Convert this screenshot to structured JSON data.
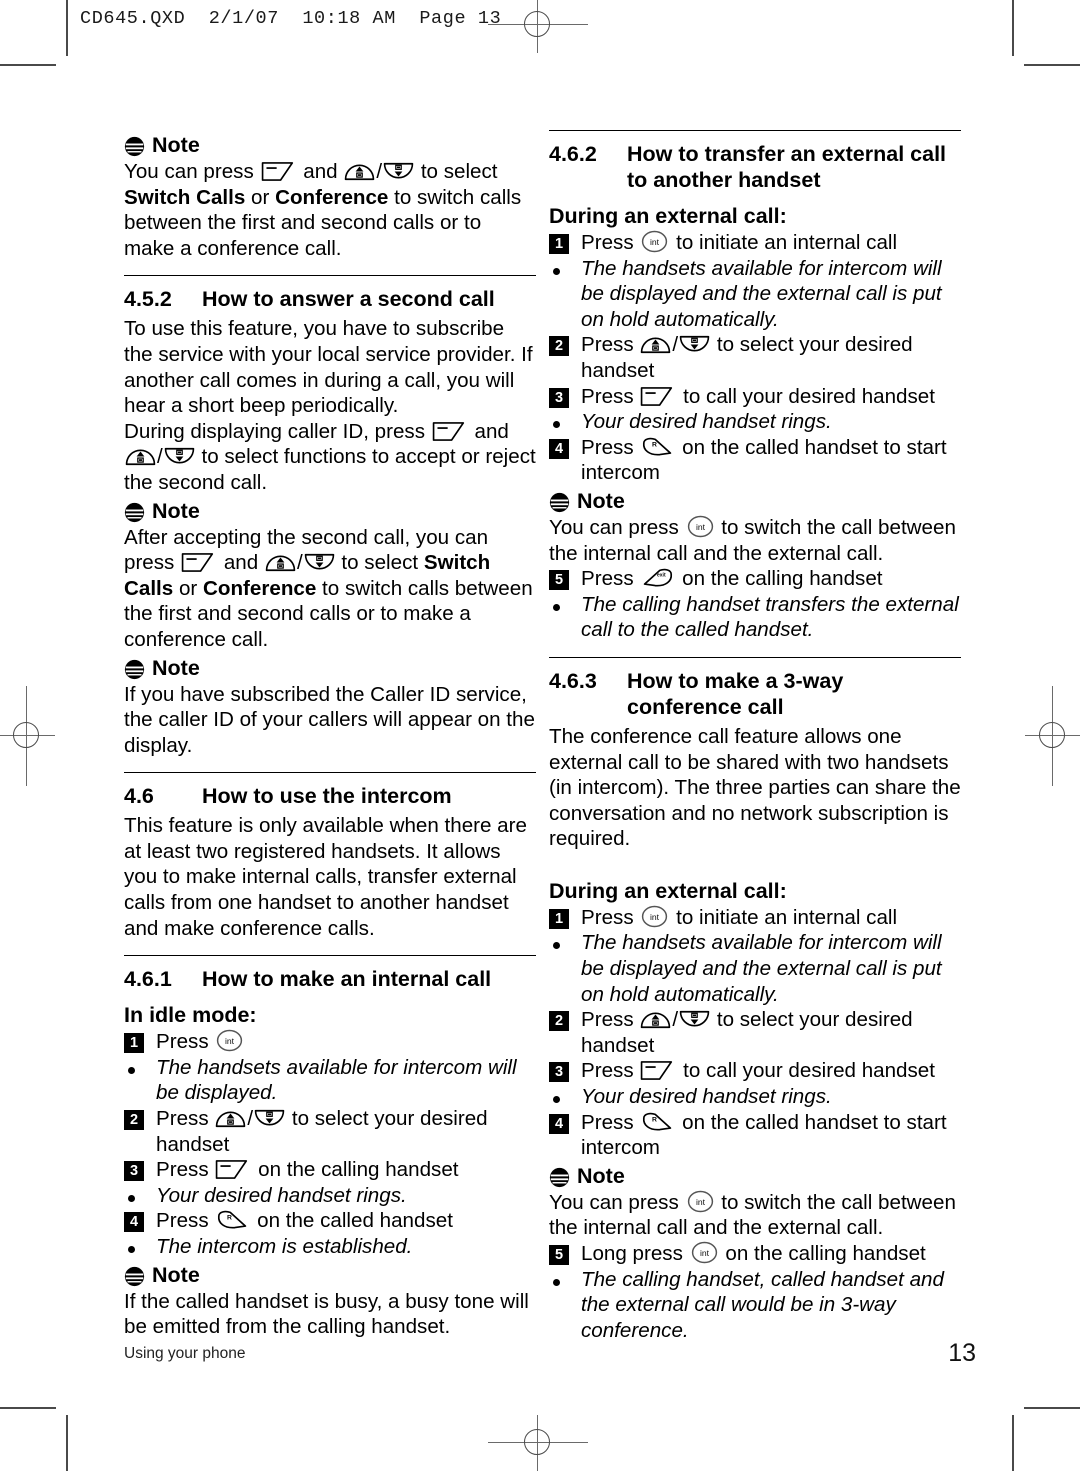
{
  "file_header": "CD645.QXD  2/1/07  10:18 AM  Page 13",
  "footer": {
    "chapter": "Using your phone",
    "page_number": "13"
  },
  "icons": {
    "note": "note-icon",
    "softkey_left": "left-softkey-icon",
    "nav_up": "nav-up-key-icon",
    "nav_down": "nav-down-key-icon",
    "int": "int-key-icon",
    "talk": "talk-key-icon",
    "exit": "exit-key-icon"
  },
  "left_column": {
    "note_1": {
      "label": "Note",
      "line_1_a": "You can press",
      "line_1_b": "and",
      "line_1_c": "to select",
      "bold_1": "Switch Calls",
      "mid_1": "or",
      "bold_2": "Conference",
      "tail": "to switch calls between the first and second calls or to make a conference call."
    },
    "section_452": {
      "number": "4.5.2",
      "title": "How to answer a second call",
      "para_1": "To use this feature, you have to subscribe the service with your local service provider. If another call comes in during a call, you will hear a short beep periodically.",
      "para_2_a": "During displaying caller ID, press",
      "para_2_b": "and",
      "para_2_c": "to select functions to accept or reject the second call."
    },
    "note_2": {
      "label": "Note",
      "a": "After accepting the second call, you can press",
      "b": "and",
      "c": "to select",
      "bold_1": "Switch Calls",
      "mid": "or",
      "bold_2": "Conference",
      "tail": "to switch calls between the first and second calls or to make a conference call."
    },
    "note_3": {
      "label": "Note",
      "text": "If you have subscribed the Caller ID service, the caller ID of your callers will appear on the display."
    },
    "section_46": {
      "number": "4.6",
      "title": "How to use the intercom",
      "para": "This feature is only available when there are at least two registered handsets.  It allows you to make internal calls, transfer external calls from one handset to another handset and make conference calls."
    },
    "section_461": {
      "number": "4.6.1",
      "title": "How to make an internal call",
      "mode_heading": "In idle mode:",
      "steps": [
        {
          "marker": "1",
          "type": "number",
          "text_before": "Press",
          "text_after": "",
          "italic": false
        },
        {
          "marker": "•",
          "type": "bullet",
          "text_before": "The handsets available for intercom will be displayed.",
          "text_after": "",
          "italic": true
        },
        {
          "marker": "2",
          "type": "number",
          "text_before": "Press",
          "text_after": "to select your desired handset",
          "italic": false
        },
        {
          "marker": "3",
          "type": "number",
          "text_before": "Press",
          "text_after": "on the calling handset",
          "italic": false
        },
        {
          "marker": "•",
          "type": "bullet",
          "text_before": "Your desired handset rings.",
          "text_after": "",
          "italic": true
        },
        {
          "marker": "4",
          "type": "number",
          "text_before": "Press",
          "text_after": "on the called handset",
          "italic": false
        },
        {
          "marker": "•",
          "type": "bullet",
          "text_before": "The intercom is established.",
          "text_after": "",
          "italic": true
        }
      ],
      "note": {
        "label": "Note",
        "text": "If the called handset is busy, a busy tone will be emitted from the calling handset."
      }
    }
  },
  "right_column": {
    "section_462": {
      "number": "4.6.2",
      "title": "How to transfer an external call to another handset",
      "mode_heading": "During an external call:",
      "steps": [
        {
          "marker": "1",
          "type": "number",
          "text_before": "Press",
          "text_after": "to initiate an internal call",
          "italic": false
        },
        {
          "marker": "•",
          "type": "bullet",
          "text_before": "The handsets available for intercom will be displayed and the external call is put on hold automatically.",
          "text_after": "",
          "italic": true
        },
        {
          "marker": "2",
          "type": "number",
          "text_before": "Press",
          "text_after": "to select your desired handset",
          "italic": false
        },
        {
          "marker": "3",
          "type": "number",
          "text_before": "Press",
          "text_after": "to call your desired handset",
          "italic": false
        },
        {
          "marker": "•",
          "type": "bullet",
          "text_before": "Your desired handset rings.",
          "text_after": "",
          "italic": true
        },
        {
          "marker": "4",
          "type": "number",
          "text_before": "Press",
          "text_after": "on the called handset to start intercom",
          "italic": false
        }
      ],
      "note": {
        "label": "Note",
        "a": "You can press",
        "b": "to switch the call between the internal call and the external call."
      },
      "step_5": {
        "marker": "5",
        "text_before": "Press",
        "text_after": "on the calling handset"
      },
      "bullet_5": "The calling handset transfers the external call to the called handset."
    },
    "section_463": {
      "number": "4.6.3",
      "title": "How to make a 3-way conference call",
      "para": "The conference call feature allows one external call to be shared with two handsets (in intercom). The three parties can share the conversation and no network subscription is required.",
      "mode_heading": "During an external call:",
      "steps": [
        {
          "marker": "1",
          "type": "number",
          "text_before": "Press",
          "text_after": "to initiate an internal call",
          "italic": false
        },
        {
          "marker": "•",
          "type": "bullet",
          "text_before": "The handsets available for intercom will be displayed and the external call is put on hold automatically.",
          "text_after": "",
          "italic": true
        },
        {
          "marker": "2",
          "type": "number",
          "text_before": "Press",
          "text_after": "to select your desired handset",
          "italic": false
        },
        {
          "marker": "3",
          "type": "number",
          "text_before": "Press",
          "text_after": "to call your desired handset",
          "italic": false
        },
        {
          "marker": "•",
          "type": "bullet",
          "text_before": "Your desired handset rings.",
          "text_after": "",
          "italic": true
        },
        {
          "marker": "4",
          "type": "number",
          "text_before": "Press",
          "text_after": "on the called handset to start intercom",
          "italic": false
        }
      ],
      "note": {
        "label": "Note",
        "a": "You can press",
        "b": "to switch the call between the internal call and the external call."
      },
      "step_5": {
        "marker": "5",
        "text_before": "Long press",
        "text_after": "on the calling handset"
      },
      "bullet_5": "The calling handset, called handset and the external call would be in 3-way conference."
    }
  }
}
